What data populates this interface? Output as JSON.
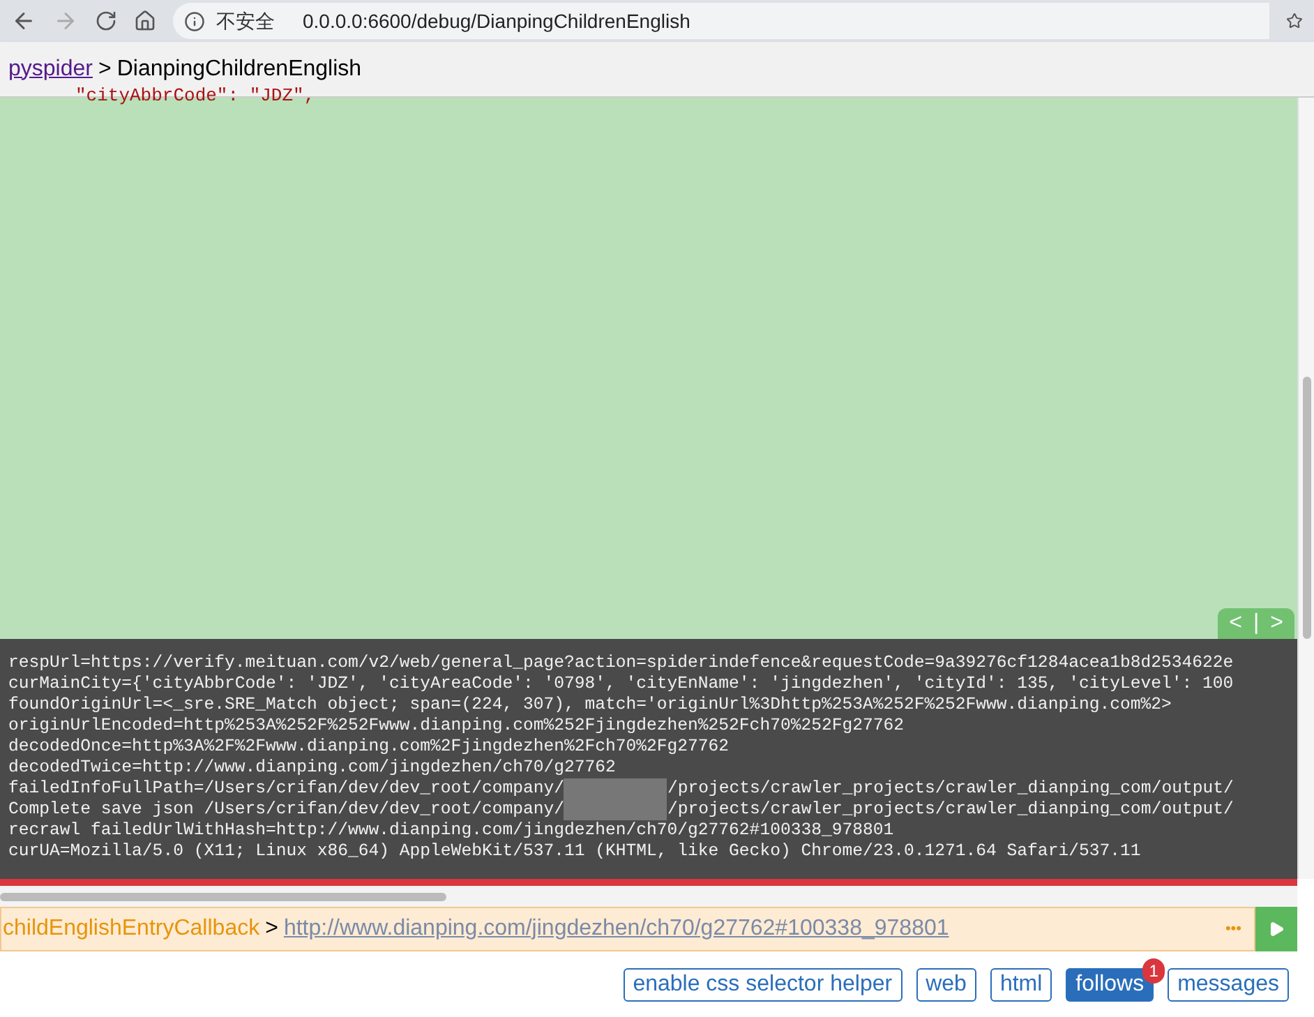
{
  "browser": {
    "security_label": "不安全",
    "address": "0.0.0.0:6600/debug/DianpingChildrenEnglish"
  },
  "breadcrumb": {
    "link": "pyspider",
    "separator": ">",
    "title": "DianpingChildrenEnglish"
  },
  "code_lines": [
    "\"cityAbbrCode\": \"JDZ\","
  ],
  "pager": {
    "prev": "<",
    "divider": "|",
    "next": ">"
  },
  "log_lines": [
    {
      "text": "respUrl=https://verify.meituan.com/v2/web/general_page?action=spiderindefence&requestCode=9a39276cf1284acea1b8d2534622e"
    },
    {
      "text": "curMainCity={'cityAbbrCode': 'JDZ', 'cityAreaCode': '0798', 'cityEnName': 'jingdezhen', 'cityId': 135, 'cityLevel': 100"
    },
    {
      "text": "foundOriginUrl=<_sre.SRE_Match object; span=(224, 307), match='originUrl%3Dhttp%253A%252F%252Fwww.dianping.com%2>"
    },
    {
      "text": "originUrlEncoded=http%253A%252F%252Fwww.dianping.com%252Fjingdezhen%252Fch70%252Fg27762"
    },
    {
      "text": "decodedOnce=http%3A%2F%2Fwww.dianping.com%2Fjingdezhen%2Fch70%2Fg27762"
    },
    {
      "text": "decodedTwice=http://www.dianping.com/jingdezhen/ch70/g27762"
    },
    {
      "text": "failedInfoFullPath=/Users/crifan/dev/dev_root/company/",
      "redacted": true,
      "after": "/projects/crawler_projects/crawler_dianping_com/output/"
    },
    {
      "text": "Complete save json /Users/crifan/dev/dev_root/company/",
      "redacted": true,
      "after": "/projects/crawler_projects/crawler_dianping_com/output/"
    },
    {
      "text": "recrawl failedUrlWithHash=http://www.dianping.com/jingdezhen/ch70/g27762#100338_978801"
    },
    {
      "text": "curUA=Mozilla/5.0 (X11; Linux x86_64) AppleWebKit/537.11 (KHTML, like Gecko) Chrome/23.0.1271.64 Safari/537.11"
    }
  ],
  "task_bar": {
    "callback": "childEnglishEntryCallback",
    "separator": ">",
    "url": "http://www.dianping.com/jingdezhen/ch70/g27762#100338_978801",
    "more": "•••"
  },
  "tabs": [
    {
      "label": "enable css selector helper",
      "selected": false
    },
    {
      "label": "web",
      "selected": false
    },
    {
      "label": "html",
      "selected": false
    },
    {
      "label": "follows",
      "selected": true,
      "badge": "1"
    },
    {
      "label": "messages",
      "selected": false
    }
  ]
}
